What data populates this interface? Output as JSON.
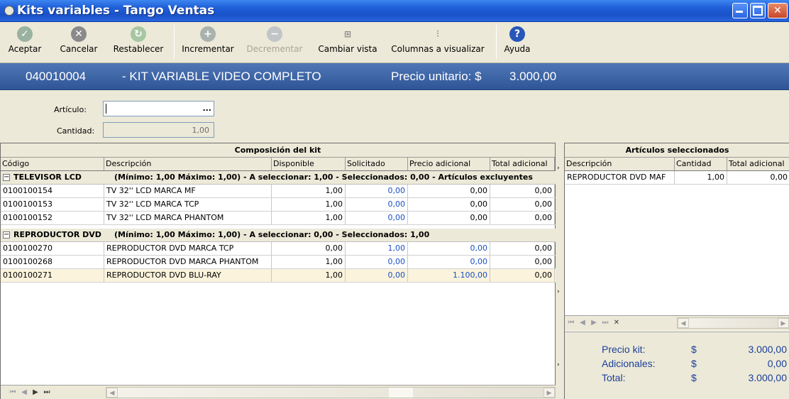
{
  "window": {
    "title": "Kits variables - Tango Ventas"
  },
  "toolbar": {
    "aceptar": "Aceptar",
    "cancelar": "Cancelar",
    "restablecer": "Restablecer",
    "incrementar": "Incrementar",
    "decrementar": "Decrementar",
    "cambiar_vista": "Cambiar vista",
    "columnas": "Columnas a visualizar",
    "ayuda": "Ayuda"
  },
  "header": {
    "code": "040010004",
    "name": "- KIT VARIABLE VIDEO COMPLETO",
    "price_label": "Precio unitario: $",
    "price_value": "3.000,00"
  },
  "form": {
    "articulo_label": "Artículo:",
    "articulo_value": "",
    "articulo_btn": "...",
    "cantidad_label": "Cantidad:",
    "cantidad_value": "1,00"
  },
  "kit": {
    "title": "Composición del kit",
    "columns": [
      "Código",
      "Descripción",
      "Disponible",
      "Solicitado",
      "Precio adicional",
      "Total adicional"
    ],
    "groups": [
      {
        "name": "TELEVISOR LCD",
        "info": "(Mínimo: 1,00 Máximo: 1,00)  -  A seleccionar: 1,00  -  Seleccionados: 0,00  -  Artículos excluyentes",
        "rows": [
          {
            "code": "0100100154",
            "desc": "TV 32'' LCD MARCA MF",
            "disp": "1,00",
            "sol": "0,00",
            "precio": "0,00",
            "total": "0,00"
          },
          {
            "code": "0100100153",
            "desc": "TV 32'' LCD MARCA TCP",
            "disp": "1,00",
            "sol": "0,00",
            "precio": "0,00",
            "total": "0,00"
          },
          {
            "code": "0100100152",
            "desc": "TV 32'' LCD MARCA PHANTOM",
            "disp": "1,00",
            "sol": "0,00",
            "precio": "0,00",
            "total": "0,00"
          }
        ]
      },
      {
        "name": "REPRODUCTOR DVD",
        "info": "(Mínimo: 1,00 Máximo: 1,00)  -  A seleccionar: 0,00  -  Seleccionados: 1,00",
        "rows": [
          {
            "code": "0100100270",
            "desc": "REPRODUCTOR DVD MARCA TCP",
            "disp": "0,00",
            "sol": "1,00",
            "precio": "0,00",
            "total": "0,00"
          },
          {
            "code": "0100100268",
            "desc": "REPRODUCTOR DVD MARCA PHANTOM",
            "disp": "1,00",
            "sol": "0,00",
            "precio": "0,00",
            "total": "0,00"
          },
          {
            "code": "0100100271",
            "desc": "REPRODUCTOR DVD BLU-RAY",
            "disp": "1,00",
            "sol": "0,00",
            "precio": "1.100,00",
            "total": "0,00"
          }
        ]
      }
    ]
  },
  "selected": {
    "title": "Artículos seleccionados",
    "columns": [
      "Descripción",
      "Cantidad",
      "Total adicional"
    ],
    "rows": [
      {
        "desc": "REPRODUCTOR DVD MAF",
        "cant": "1,00",
        "total": "0,00"
      }
    ]
  },
  "totals": {
    "precio_kit_label": "Precio kit:",
    "precio_kit_value": "3.000,00",
    "adicionales_label": "Adicionales:",
    "adicionales_value": "0,00",
    "total_label": "Total:",
    "total_value": "3.000,00",
    "currency": "$"
  },
  "colors": {
    "titlebar": "#1f5fd8",
    "header": "#3a62a5",
    "link_blue": "#1a4fc4",
    "totals_text": "#1a3f9a"
  }
}
